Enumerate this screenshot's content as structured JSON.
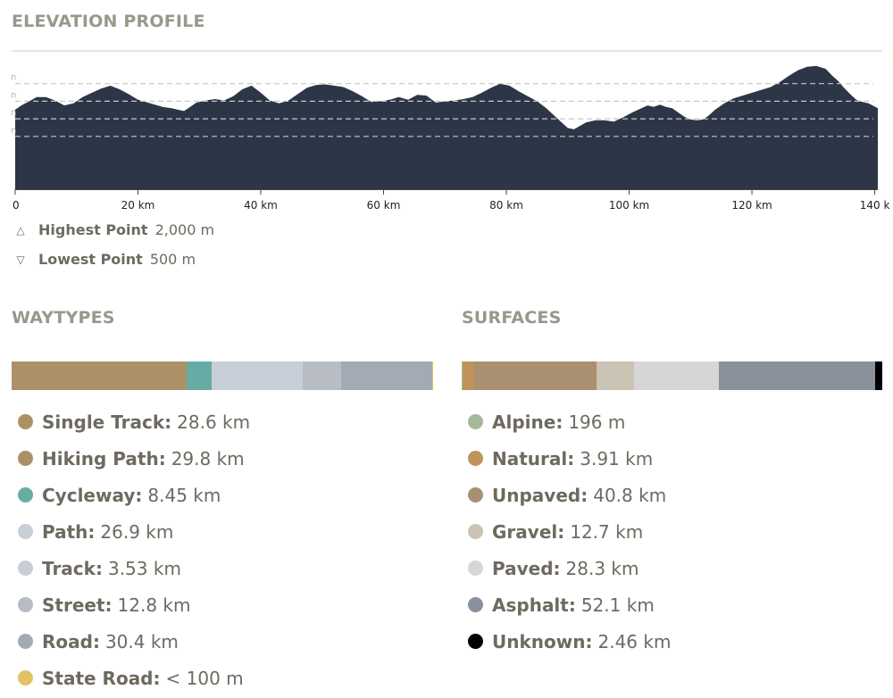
{
  "elevation": {
    "title": "ELEVATION PROFILE",
    "y_tick_label": "n",
    "highest_label": "Highest Point",
    "highest_value": "2,000 m",
    "lowest_label": "Lowest Point",
    "lowest_value": "500 m"
  },
  "chart_data": {
    "type": "area",
    "title": "ELEVATION PROFILE",
    "xlabel": "",
    "ylabel": "",
    "x_tick_labels": [
      "0",
      "20 km",
      "40 km",
      "60 km",
      "80 km",
      "100 km",
      "120 km",
      "140 k"
    ],
    "x_ticks": [
      0,
      20,
      40,
      60,
      80,
      100,
      120,
      140
    ],
    "xlim": [
      0,
      140.5
    ],
    "ylim": [
      250,
      2050
    ],
    "y_gridlines": [
      1000,
      1250,
      1500,
      1750
    ],
    "grid": true,
    "fill_color": "#2c3646",
    "x": [
      0,
      1,
      2.5,
      3.5,
      5,
      6.5,
      8,
      9.5,
      11,
      12.5,
      14,
      15.5,
      17,
      18.5,
      20,
      22,
      24,
      25.5,
      26.5,
      27.5,
      28.5,
      29.5,
      31,
      32.5,
      34,
      35.5,
      37,
      38.5,
      40,
      41.5,
      43,
      44.5,
      46,
      47.5,
      49,
      50.5,
      52,
      53.5,
      55,
      56.5,
      58,
      59.5,
      61,
      62.5,
      64,
      65.5,
      67,
      68.5,
      70,
      71.5,
      73,
      74.5,
      76,
      77.5,
      79,
      80.5,
      82,
      83.5,
      85,
      86.5,
      88,
      89,
      90,
      91,
      92,
      93,
      94.5,
      96,
      97.5,
      99,
      100.5,
      102,
      103,
      104,
      105,
      106,
      107,
      108,
      109,
      110,
      111,
      112,
      113,
      114,
      115.5,
      117,
      118.5,
      120,
      121.5,
      123,
      124.5,
      126,
      127.5,
      129,
      130.5,
      132,
      133,
      134,
      135,
      136,
      137,
      138,
      139,
      140.5
    ],
    "y": [
      1380,
      1440,
      1510,
      1560,
      1560,
      1510,
      1440,
      1470,
      1560,
      1620,
      1680,
      1720,
      1670,
      1600,
      1520,
      1470,
      1420,
      1400,
      1380,
      1360,
      1420,
      1480,
      1510,
      1530,
      1510,
      1570,
      1670,
      1720,
      1620,
      1510,
      1470,
      1510,
      1600,
      1690,
      1730,
      1740,
      1720,
      1700,
      1640,
      1570,
      1490,
      1500,
      1520,
      1560,
      1520,
      1590,
      1580,
      1480,
      1500,
      1510,
      1530,
      1560,
      1620,
      1690,
      1750,
      1720,
      1640,
      1570,
      1500,
      1400,
      1280,
      1200,
      1120,
      1100,
      1150,
      1200,
      1230,
      1230,
      1210,
      1270,
      1340,
      1400,
      1440,
      1420,
      1450,
      1420,
      1400,
      1340,
      1280,
      1240,
      1230,
      1240,
      1300,
      1380,
      1470,
      1540,
      1580,
      1620,
      1660,
      1700,
      1770,
      1860,
      1940,
      1990,
      2000,
      1960,
      1870,
      1790,
      1690,
      1600,
      1520,
      1490,
      1470,
      1400
    ]
  },
  "waytypes": {
    "title": "WAYTYPES",
    "bar": [
      {
        "color": "#ad9067",
        "value": 28.6
      },
      {
        "color": "#ad9067",
        "value": 29.8
      },
      {
        "color": "#67aca4",
        "value": 8.45
      },
      {
        "color": "#c8ced7",
        "value": 26.9
      },
      {
        "color": "#c8ced7",
        "value": 3.53
      },
      {
        "color": "#b7bcc5",
        "value": 12.8
      },
      {
        "color": "#a4aab5",
        "value": 30.4
      },
      {
        "color": "#e3c266",
        "value": 0.05
      }
    ],
    "items": [
      {
        "label": "Single Track",
        "amount": "28.6 km",
        "color": "#ad9067"
      },
      {
        "label": "Hiking Path",
        "amount": "29.8 km",
        "color": "#ad9067"
      },
      {
        "label": "Cycleway",
        "amount": "8.45 km",
        "color": "#67aca4"
      },
      {
        "label": "Path",
        "amount": "26.9 km",
        "color": "#c8ced7"
      },
      {
        "label": "Track",
        "amount": "3.53 km",
        "color": "#c8ced7"
      },
      {
        "label": "Street",
        "amount": "12.8 km",
        "color": "#b7bcc5"
      },
      {
        "label": "Road",
        "amount": "30.4 km",
        "color": "#a4aab5"
      },
      {
        "label": "State Road",
        "amount": "< 100 m",
        "color": "#e3c266"
      }
    ]
  },
  "surfaces": {
    "title": "SURFACES",
    "bar": [
      {
        "color": "#a8b89a",
        "value": 0.196
      },
      {
        "color": "#c0935a",
        "value": 3.91
      },
      {
        "color": "#a99072",
        "value": 40.8
      },
      {
        "color": "#cbc3b3",
        "value": 12.7
      },
      {
        "color": "#d6d6d6",
        "value": 28.3
      },
      {
        "color": "#8a919d",
        "value": 52.1
      },
      {
        "color": "#000000",
        "value": 2.46
      }
    ],
    "items": [
      {
        "label": "Alpine",
        "amount": "196 m",
        "color": "#a8b89a"
      },
      {
        "label": "Natural",
        "amount": "3.91 km",
        "color": "#c0935a"
      },
      {
        "label": "Unpaved",
        "amount": "40.8 km",
        "color": "#a99072"
      },
      {
        "label": "Gravel",
        "amount": "12.7 km",
        "color": "#cbc3b3"
      },
      {
        "label": "Paved",
        "amount": "28.3 km",
        "color": "#d6d6d6"
      },
      {
        "label": "Asphalt",
        "amount": "52.1 km",
        "color": "#8a919d"
      },
      {
        "label": "Unknown",
        "amount": "2.46 km",
        "color": "#000000"
      }
    ]
  }
}
